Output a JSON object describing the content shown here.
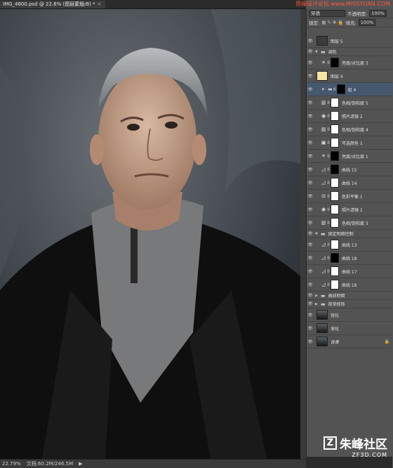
{
  "tab": {
    "title": "IMG_4600.psd @ 22.8% (图层蒙版/8) *",
    "close": "×"
  },
  "top_watermark": "思缘设计论坛  www.MISSYUAN.COM",
  "panel": {
    "blend_mode": "穿透",
    "opacity_label": "不透明度:",
    "opacity_value": "100%",
    "lock_label": "锁定:",
    "fill_label": "填充:",
    "fill_value": "100%"
  },
  "layers": [
    {
      "name": "图层 5",
      "kind": "pixel",
      "thumb": "#3a3a3a"
    },
    {
      "name": "调色",
      "kind": "group"
    },
    {
      "name": "亮度/对比度 3",
      "kind": "adj",
      "icon": "☀",
      "mask": "dark"
    },
    {
      "name": "图层 4",
      "kind": "pixel",
      "thumb": "#f3e4a4"
    },
    {
      "name": "组 4",
      "kind": "group-sel",
      "mask": "dark"
    },
    {
      "name": "色相/饱和度 5",
      "kind": "adj",
      "icon": "▥",
      "mask": "white"
    },
    {
      "name": "照片滤镜 2",
      "kind": "adj",
      "icon": "◉",
      "mask": "white"
    },
    {
      "name": "色相/饱和度 4",
      "kind": "adj",
      "icon": "▥",
      "mask": "white"
    },
    {
      "name": "可选颜色 1",
      "kind": "adj",
      "icon": "▣",
      "mask": "white"
    },
    {
      "name": "亮度/对比度 1",
      "kind": "adj",
      "icon": "☀",
      "mask": "dark"
    },
    {
      "name": "曲线 15",
      "kind": "adj",
      "icon": "◿",
      "mask": "dark"
    },
    {
      "name": "曲线 14",
      "kind": "adj",
      "icon": "◿",
      "mask": "white"
    },
    {
      "name": "色彩平衡 1",
      "kind": "adj",
      "icon": "⚖",
      "mask": "white"
    },
    {
      "name": "照片滤镜 1",
      "kind": "adj",
      "icon": "◉",
      "mask": "white"
    },
    {
      "name": "色相/饱和度 3",
      "kind": "adj",
      "icon": "▥",
      "mask": "white"
    },
    {
      "name": "固定明暗控制",
      "kind": "group"
    },
    {
      "name": "曲线 13",
      "kind": "adj",
      "icon": "◿",
      "mask": "white"
    },
    {
      "name": "曲线 18",
      "kind": "adj",
      "icon": "◿",
      "mask": "dark"
    },
    {
      "name": "曲线 17",
      "kind": "adj",
      "icon": "◿",
      "mask": "white"
    },
    {
      "name": "曲线 16",
      "kind": "adj",
      "icon": "◿",
      "mask": "white"
    },
    {
      "name": "曲线明暗",
      "kind": "group-closed"
    },
    {
      "name": "简单修饰",
      "kind": "group-closed"
    },
    {
      "name": "锐化",
      "kind": "photo"
    },
    {
      "name": "液化",
      "kind": "photo"
    },
    {
      "name": "背景",
      "kind": "photo-bg"
    }
  ],
  "status": {
    "zoom": "22.79%",
    "doc": "文档:60.2M/246.5M",
    "arrow": "▶"
  },
  "bottom_watermark": {
    "brand": "朱峰社区",
    "site": "ZF3D.COM",
    "logo": "Z"
  },
  "colors": {
    "accent": "#46586e",
    "watermark_red": "#ff5a3c"
  },
  "icons": {
    "eye": "eye-icon",
    "folder": "folder-icon",
    "link": "chain-link-icon"
  }
}
